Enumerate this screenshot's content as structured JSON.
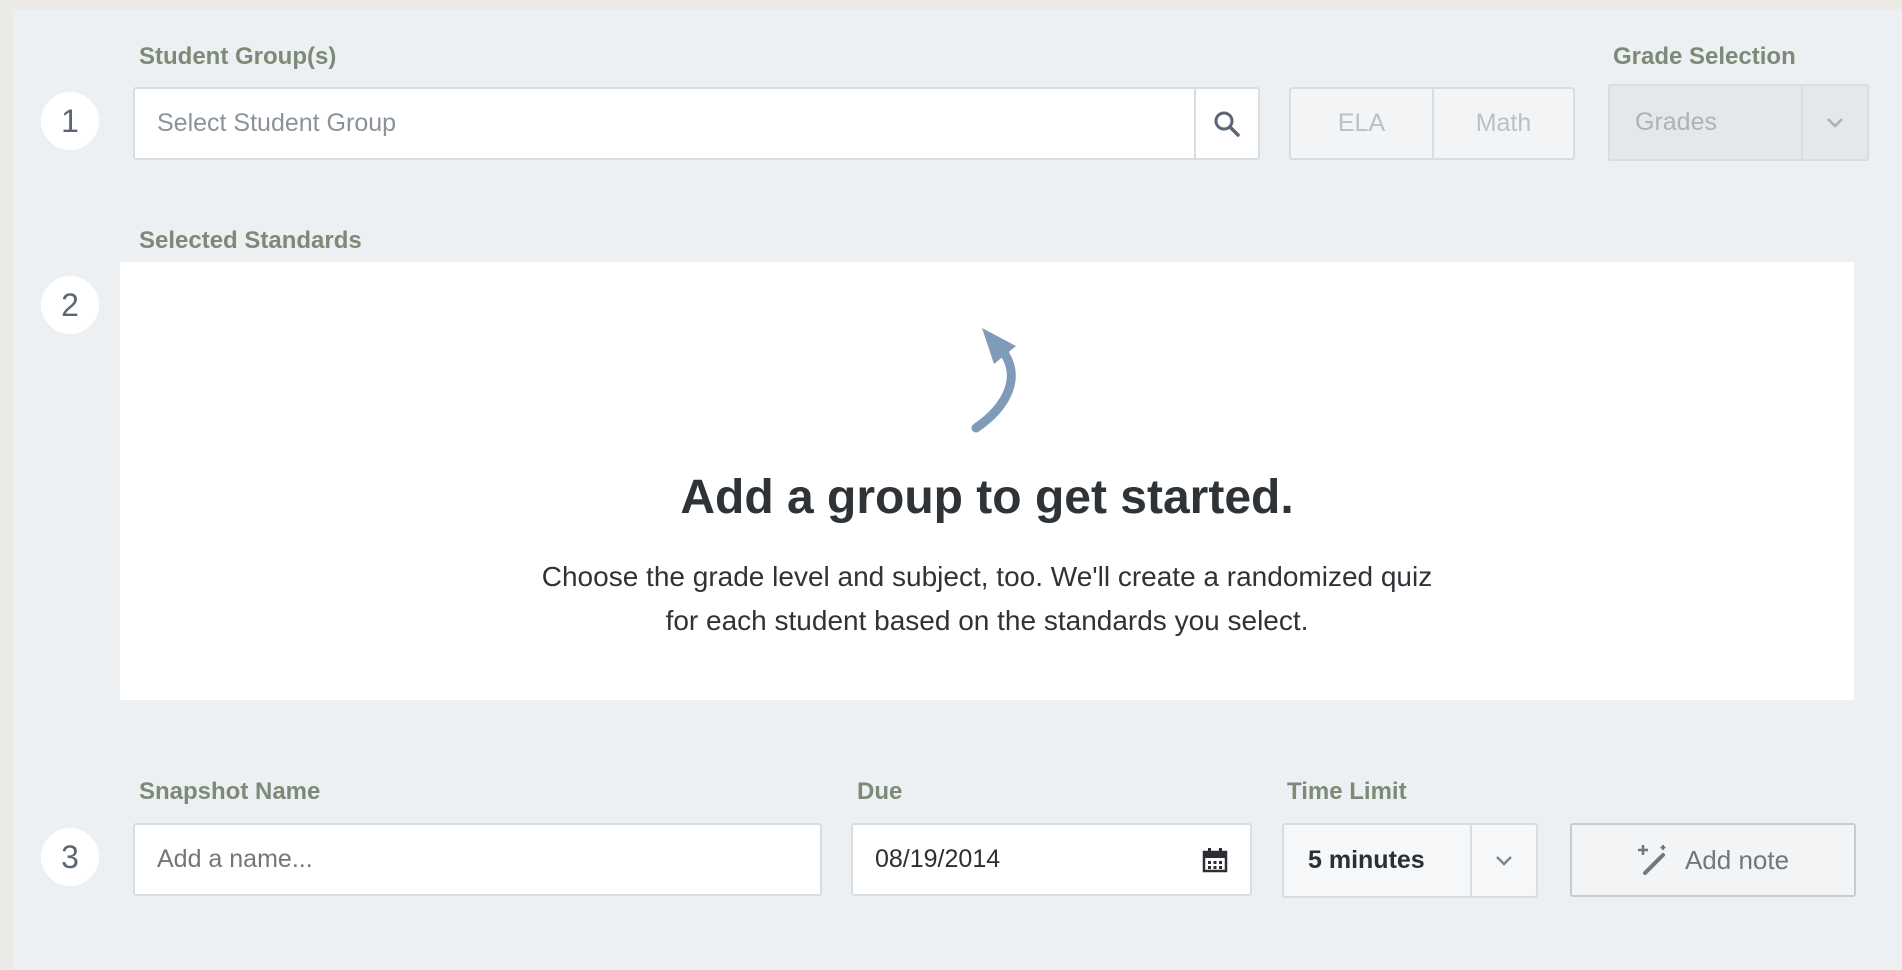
{
  "steps": [
    "1",
    "2",
    "3"
  ],
  "student_group": {
    "label": "Student Group(s)",
    "placeholder": "Select Student Group",
    "search_icon": "search-icon"
  },
  "subject_toggle": {
    "ela": "ELA",
    "math": "Math"
  },
  "grade_selection": {
    "label": "Grade Selection",
    "value": "Grades",
    "icon": "chevron-down-icon"
  },
  "standards": {
    "label": "Selected Standards",
    "icon": "curved-arrow-up-icon",
    "headline": "Add a group to get started.",
    "line1": "Choose the grade level and subject, too. We'll create a randomized quiz",
    "line2": "for each student based on the standards you select."
  },
  "snapshot": {
    "label": "Snapshot Name",
    "placeholder": "Add a name..."
  },
  "due": {
    "label": "Due",
    "value": "08/19/2014",
    "icon": "calendar-icon"
  },
  "time_limit": {
    "label": "Time Limit",
    "value": "5 minutes",
    "icon": "chevron-down-icon"
  },
  "add_note": {
    "label": "Add note",
    "icon": "magic-wand-icon"
  },
  "colors": {
    "panel_bg": "#edf0f2",
    "label_green": "#7d8a78",
    "arrow_blue": "#7f9bb8",
    "text_dark": "#2e3338"
  }
}
